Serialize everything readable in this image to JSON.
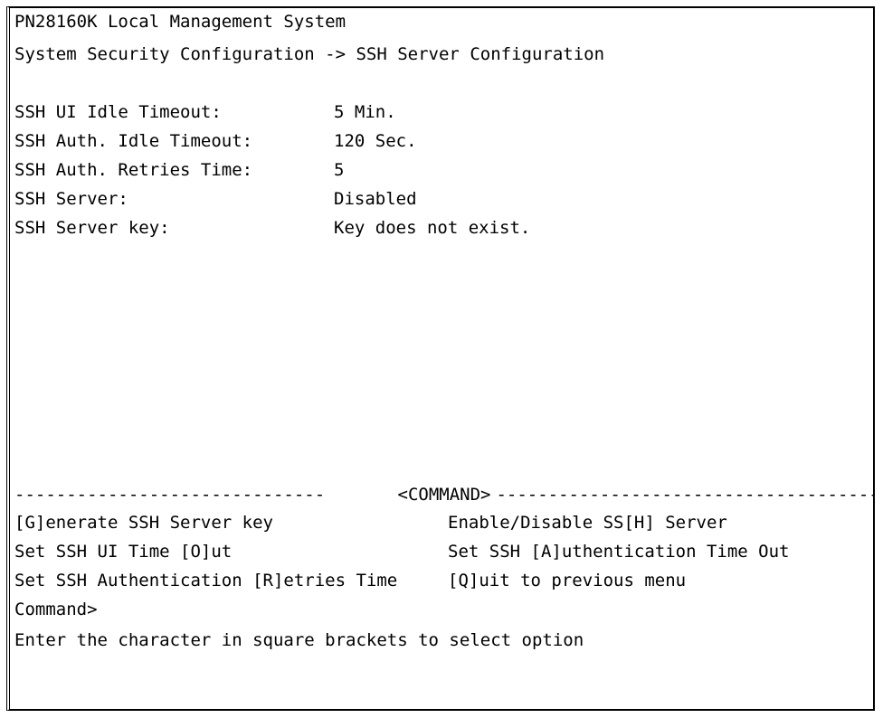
{
  "header": {
    "system_title": "PN28160K Local Management System",
    "breadcrumb": "System Security Configuration -> SSH Server Configuration"
  },
  "settings": [
    {
      "label": "SSH UI Idle Timeout:",
      "value": "5 Min."
    },
    {
      "label": "SSH Auth. Idle Timeout:",
      "value": "120 Sec."
    },
    {
      "label": "SSH Auth. Retries Time:",
      "value": "5"
    },
    {
      "label": "SSH Server:",
      "value": "Disabled"
    },
    {
      "label": "SSH Server key:",
      "value": "Key does not exist."
    }
  ],
  "command_section": {
    "separator_label": "<COMMAND>",
    "dashes_left": "------------------------------",
    "dashes_right": "--------------------------------------------------"
  },
  "commands": [
    {
      "label": "[G]enerate SSH Server key"
    },
    {
      "label": "Enable/Disable SS[H] Server"
    },
    {
      "label": "Set SSH UI Time [O]ut"
    },
    {
      "label": "Set SSH [A]uthentication Time Out"
    },
    {
      "label": "Set SSH Authentication [R]etries Time"
    },
    {
      "label": "[Q]uit to previous menu"
    }
  ],
  "prompt": {
    "text": "Command>",
    "input_value": ""
  },
  "help_text": "Enter the character in square brackets to select option"
}
